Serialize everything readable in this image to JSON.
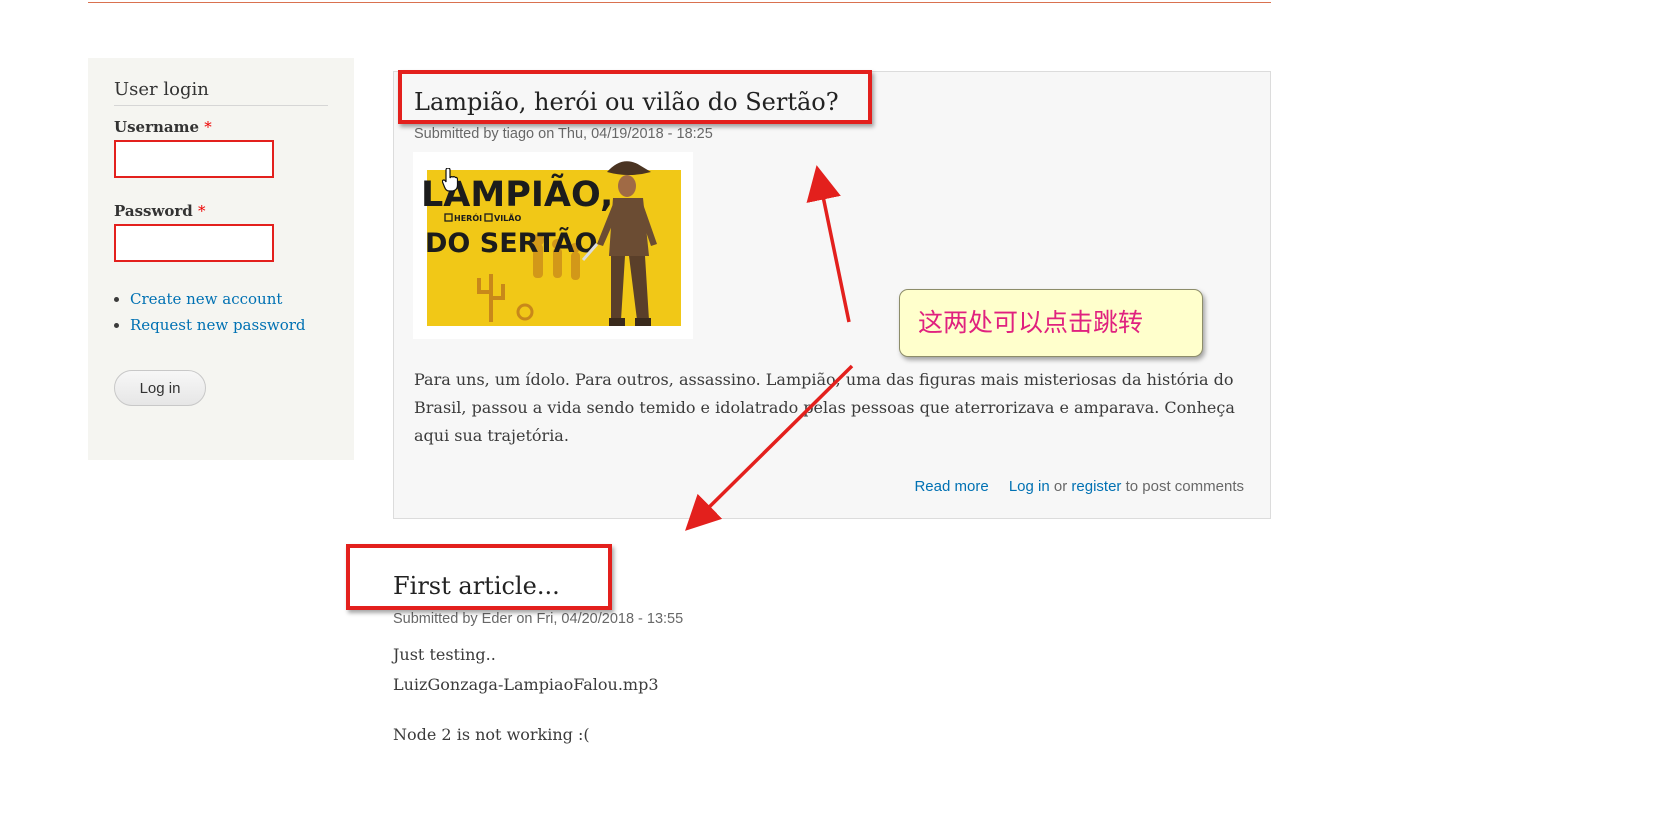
{
  "sidebar": {
    "block_title": "User login",
    "username_label": "Username",
    "password_label": "Password",
    "required_marker": "*",
    "links": [
      "Create new account",
      "Request new password"
    ],
    "login_button": "Log in"
  },
  "article1": {
    "title": "Lampião, herói ou vilão do Sertão?",
    "meta": "Submitted by tiago on Thu, 04/19/2018 - 18:25",
    "image_text": {
      "line1": "LAMPIÃO,",
      "option1": "HERÓI",
      "option2": "VILÃO",
      "line2": "DO SERTÃO"
    },
    "body": "Para uns, um ídolo. Para outros, assassino. Lampião, uma das figuras mais misteriosas da história do Brasil, passou a vida sendo temido e idolatrado pelas pessoas que aterrorizava e amparava. Conheça aqui sua trajetória.",
    "read_more": "Read more",
    "login_link": "Log in",
    "or_text": " or ",
    "register_link": "register",
    "comment_suffix": " to post comments"
  },
  "article2": {
    "title": "First article...",
    "meta": "Submitted by Eder on Fri, 04/20/2018 - 13:55",
    "body_lines": [
      "Just testing..",
      "LuizGonzaga-LampiaoFalou.mp3",
      "Node 2 is not working :("
    ]
  },
  "annotation": {
    "callout_text": "这两处可以点击跳转",
    "color": "#e3201d",
    "callout_bg": "#ffffcc",
    "callout_text_color": "#e0217f"
  },
  "colors": {
    "link": "#0071b3",
    "sidebar_bg": "#f5f5f1",
    "article_bg": "#f7f7f7"
  }
}
